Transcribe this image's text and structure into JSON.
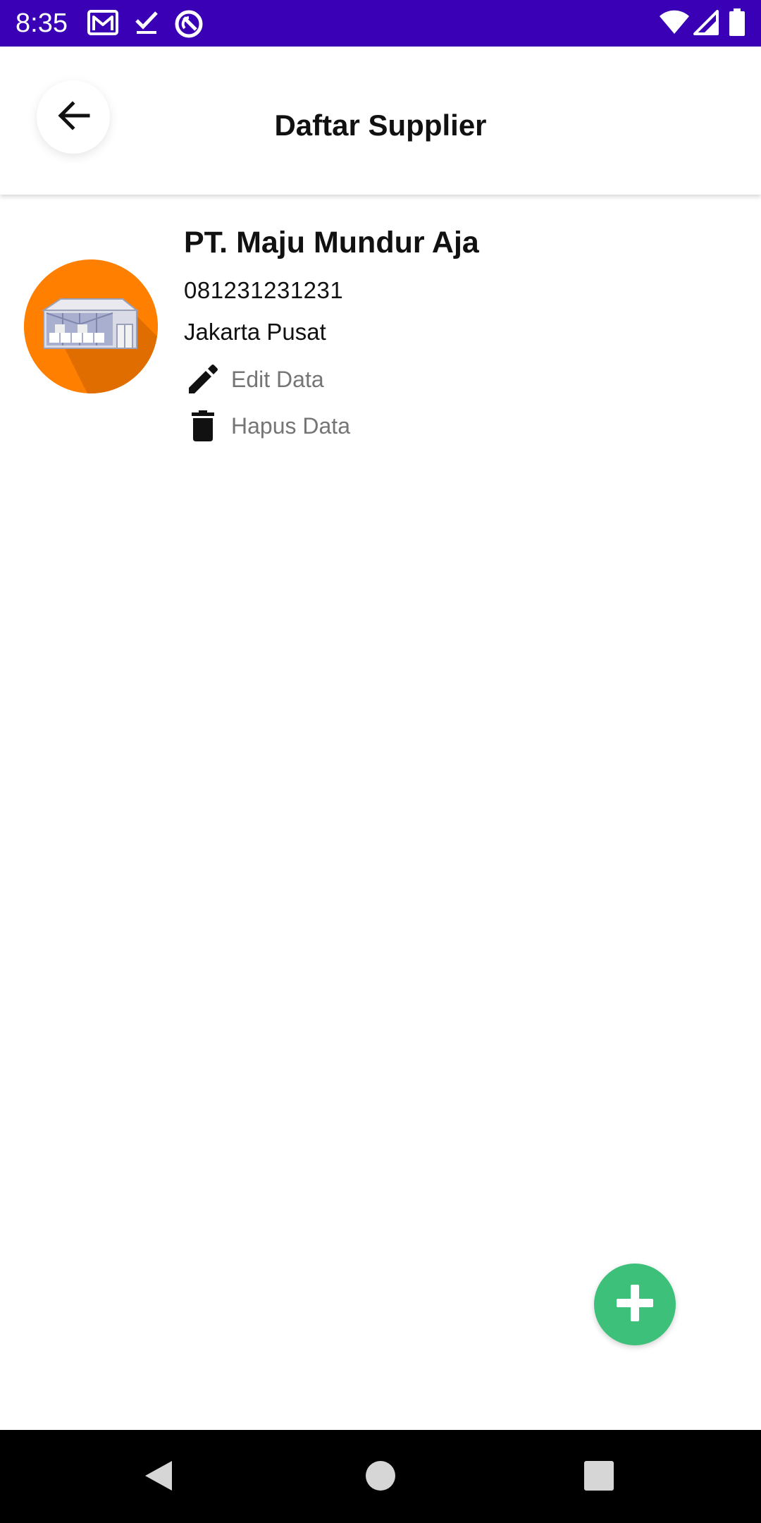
{
  "status_bar": {
    "time": "8:35",
    "left_icons": [
      "gmail-icon",
      "checkmark-icon",
      "sync-icon"
    ],
    "right_icons": [
      "wifi-icon",
      "signal-icon",
      "battery-icon"
    ],
    "background": "#3a00b5"
  },
  "app_bar": {
    "title": "Daftar Supplier",
    "back_icon": "arrow-back-icon"
  },
  "suppliers": [
    {
      "name": "PT. Maju Mundur Aja",
      "phone": "081231231231",
      "address": "Jakarta Pusat",
      "avatar_icon": "warehouse-icon",
      "avatar_color": "#ff8000",
      "edit_label": "Edit Data",
      "edit_icon": "pencil-icon",
      "delete_label": "Hapus Data",
      "delete_icon": "trash-icon"
    }
  ],
  "fab": {
    "icon": "plus-icon",
    "color": "#3dc17a"
  },
  "nav_bar": {
    "buttons": [
      "back-triangle-icon",
      "home-circle-icon",
      "recents-square-icon"
    ]
  }
}
